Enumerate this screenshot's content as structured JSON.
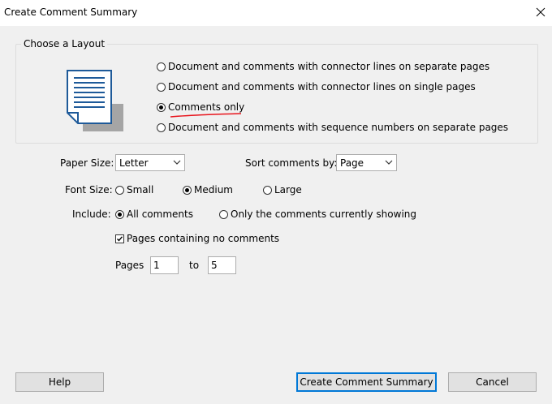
{
  "window": {
    "title": "Create Comment Summary"
  },
  "layout_group": {
    "legend": "Choose a Layout",
    "options": [
      {
        "label": "Document and comments with connector lines on separate pages",
        "selected": false
      },
      {
        "label": "Document and comments with connector lines on single pages",
        "selected": false
      },
      {
        "label": "Comments only",
        "selected": true
      },
      {
        "label": "Document and comments with sequence numbers on separate pages",
        "selected": false
      }
    ]
  },
  "paper_size": {
    "label": "Paper Size:",
    "value": "Letter"
  },
  "sort": {
    "label": "Sort comments by:",
    "value": "Page"
  },
  "font_size": {
    "label": "Font Size:",
    "options": [
      {
        "label": "Small",
        "selected": false
      },
      {
        "label": "Medium",
        "selected": true
      },
      {
        "label": "Large",
        "selected": false
      }
    ]
  },
  "include": {
    "label": "Include:",
    "options": [
      {
        "label": "All comments",
        "selected": true
      },
      {
        "label": "Only the comments currently showing",
        "selected": false
      }
    ]
  },
  "no_comment_pages": {
    "label": "Pages containing no comments",
    "checked": true
  },
  "pages": {
    "label": "Pages",
    "from": "1",
    "to_label": "to",
    "to": "5"
  },
  "buttons": {
    "help": "Help",
    "create": "Create Comment Summary",
    "cancel": "Cancel"
  },
  "colors": {
    "underline_annotation": "#e8141c",
    "default_button_border": "#0078d7",
    "icon_gray": "#a5a5a5",
    "icon_blue": "#1e5a99"
  },
  "icons": {
    "close": "close-icon",
    "layout": "document-layout-icon",
    "dropdown": "chevron-down-icon",
    "check": "checkmark-icon"
  }
}
